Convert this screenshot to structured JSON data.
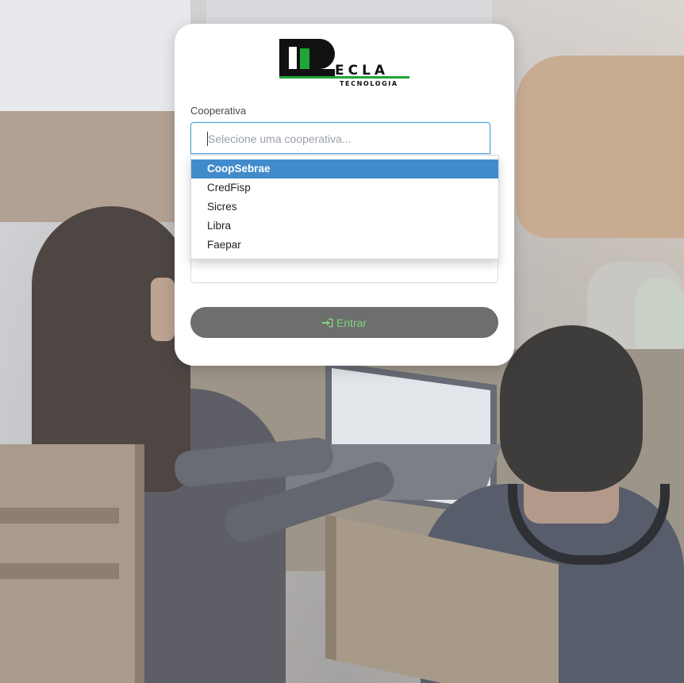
{
  "form": {
    "cooperativa_label": "Cooperativa",
    "select_placeholder": "Selecione uma cooperativa...",
    "options": [
      "CoopSebrae",
      "CredFisp",
      "Sicres",
      "Libra",
      "Faepar"
    ],
    "highlighted_option": "CoopSebrae"
  },
  "logo": {
    "word": "ECLA",
    "subtitle": "Tecnologia"
  },
  "login_button": {
    "label": "Entrar",
    "icon": "sign-in-icon"
  },
  "colors": {
    "accent": "#428bca",
    "focus_border": "#4a9fd8",
    "button_bg": "#6e6e6e",
    "button_text": "#7ed37e",
    "logo_green": "#1ea637"
  }
}
